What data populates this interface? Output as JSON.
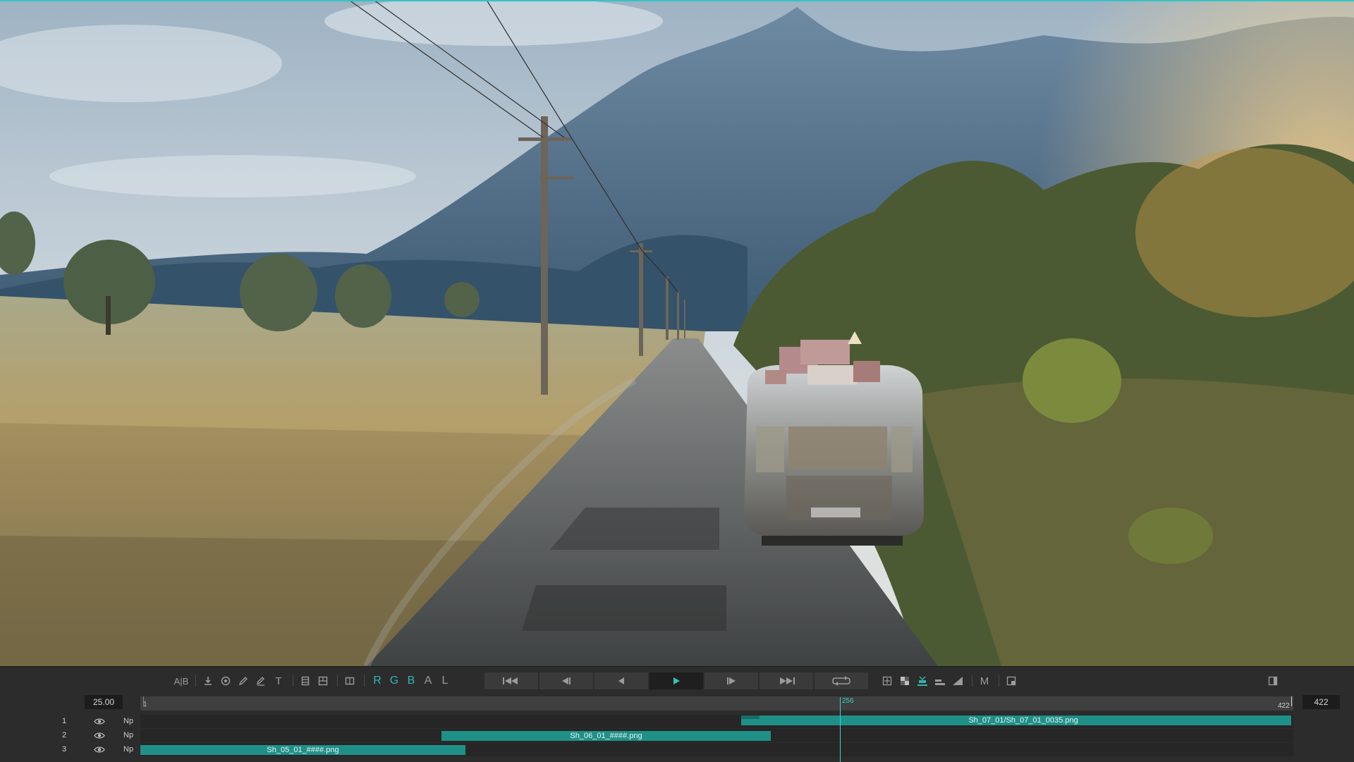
{
  "toolbar": {
    "compare_label": "A|B",
    "text_tool_label": "T",
    "channels": [
      "R",
      "G",
      "B",
      "A",
      "L"
    ],
    "active_channels": [
      "R",
      "G",
      "B"
    ],
    "mode_label": "M"
  },
  "icons": {
    "compare": "ab-compare-icon",
    "import": "import-icon",
    "stamp": "stamp-icon",
    "pencil": "pencil-icon",
    "marker": "marker-icon",
    "text": "text-icon",
    "layout_single": "layout-single-icon",
    "layout_multi": "layout-multi-icon",
    "split": "split-view-icon",
    "go_start": "go-to-start-icon",
    "step_back": "step-back-icon",
    "play_reverse": "play-reverse-icon",
    "play": "play-icon",
    "step_forward": "step-forward-icon",
    "go_end": "go-to-end-icon",
    "loop": "loop-icon",
    "safe_area": "safe-area-icon",
    "checker": "checkerboard-icon",
    "timeline_a": "timeline-icon",
    "timeline_b": "layers-icon",
    "gamma": "gamma-ramp-icon",
    "window": "window-icon",
    "sidebar": "sidebar-toggle-icon",
    "eye": "eye-icon"
  },
  "playback": {
    "fps": "25.00",
    "current_frame_label": "256",
    "end_frame": "422",
    "ruler_start_label": "1",
    "ruler_end_label": "422",
    "range": [
      1,
      422
    ],
    "current": 256
  },
  "colors": {
    "accent": "#31b5ad",
    "clip": "#1f9088",
    "panel": "#2c2c2c"
  },
  "tracks": [
    {
      "index": "1",
      "blend": "Np",
      "clips": [
        {
          "label": "Sh_07_01/Sh_07_01_0035.png",
          "start": 175,
          "end": 422,
          "lead_in": 8
        }
      ]
    },
    {
      "index": "2",
      "blend": "Np",
      "clips": [
        {
          "label": "Sh_06_01_####.png",
          "start": 68,
          "end": 218
        }
      ]
    },
    {
      "index": "3",
      "blend": "Np",
      "clips": [
        {
          "label": "Sh_05_01_####.png",
          "start": 1,
          "end": 119
        }
      ]
    }
  ]
}
